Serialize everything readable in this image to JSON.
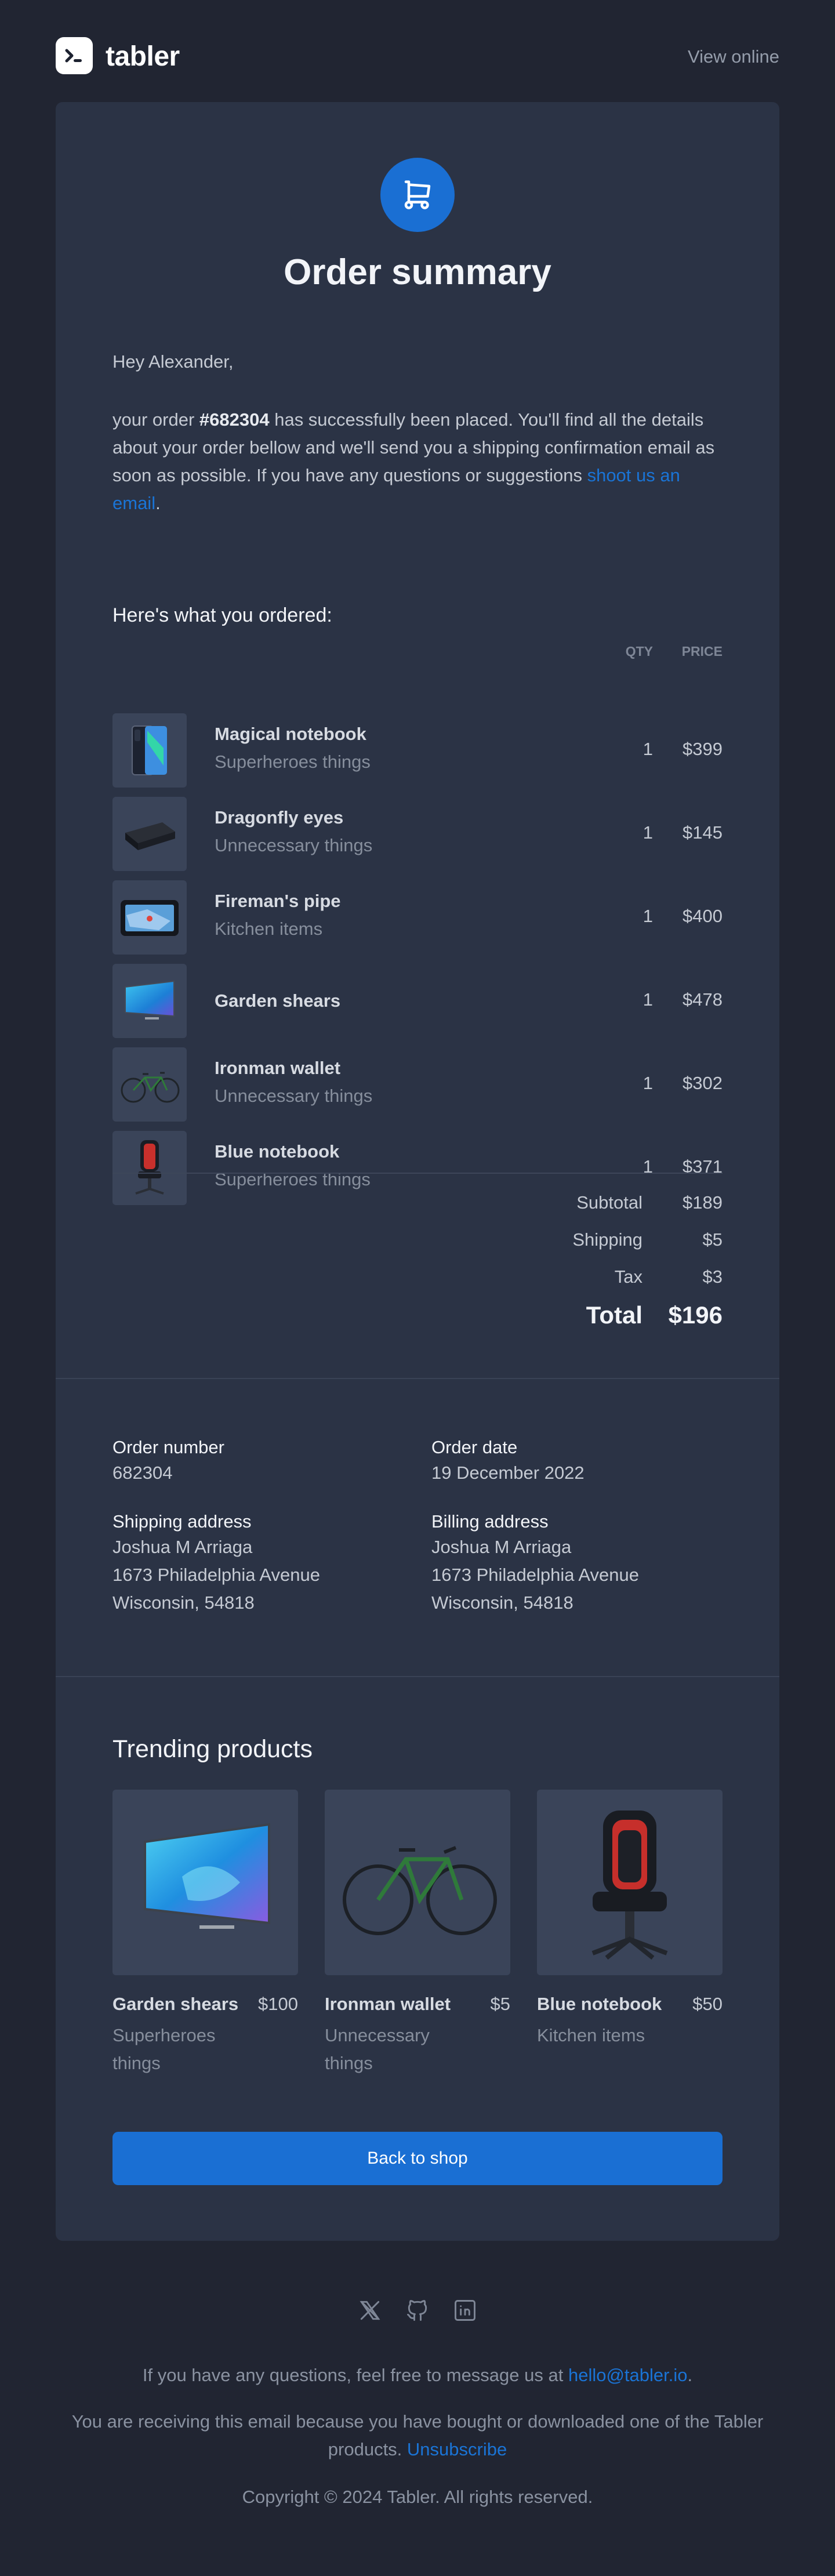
{
  "brand": {
    "name": "tabler",
    "view_online": "View online"
  },
  "colors": {
    "accent": "#1a6fd3",
    "background": "#212532",
    "card": "#2b3345",
    "link": "#1a74d6"
  },
  "order": {
    "title": "Order summary",
    "greeting": "Hey Alexander,",
    "intro_before": "your order ",
    "order_ref": "#682304",
    "intro_middle": " has successfully been placed. You'll find all the details about your order bellow and we'll send you a shipping confirmation email as soon as possible. If you have any questions or suggestions ",
    "intro_link": "shoot us an email",
    "intro_after": "."
  },
  "items": {
    "heading": "Here's what you ordered:",
    "qty_header": "QTY",
    "price_header": "PRICE",
    "rows": [
      {
        "name": "Magical notebook",
        "category": "Superheroes things",
        "qty": "1",
        "price": "$399",
        "icon": "smartphone-image"
      },
      {
        "name": "Dragonfly eyes",
        "category": "Unnecessary things",
        "qty": "1",
        "price": "$145",
        "icon": "hard-drive-image"
      },
      {
        "name": "Fireman's pipe",
        "category": "Kitchen items",
        "qty": "1",
        "price": "$400",
        "icon": "gps-device-image"
      },
      {
        "name": "Garden shears",
        "category": "",
        "qty": "1",
        "price": "$478",
        "icon": "tv-image"
      },
      {
        "name": "Ironman wallet",
        "category": "Unnecessary things",
        "qty": "1",
        "price": "$302",
        "icon": "bicycle-image"
      },
      {
        "name": "Blue notebook",
        "category": "Superheroes things",
        "qty": "1",
        "price": "$371",
        "icon": "gaming-chair-image"
      }
    ]
  },
  "summary": {
    "subtotal_label": "Subtotal",
    "subtotal": "$189",
    "shipping_label": "Shipping",
    "shipping": "$5",
    "tax_label": "Tax",
    "tax": "$3",
    "total_label": "Total",
    "total": "$196"
  },
  "details": {
    "order_number_label": "Order number",
    "order_number": "682304",
    "order_date_label": "Order date",
    "order_date": "19 December 2022",
    "shipping_label": "Shipping address",
    "shipping_lines": [
      "Joshua M Arriaga",
      "1673 Philadelphia Avenue",
      "Wisconsin, 54818"
    ],
    "billing_label": "Billing address",
    "billing_lines": [
      "Joshua M Arriaga",
      "1673 Philadelphia Avenue",
      "Wisconsin, 54818"
    ]
  },
  "trending": {
    "heading": "Trending products",
    "products": [
      {
        "name": "Garden shears",
        "price": "$100",
        "category": "Superheroes things",
        "icon": "tv-image"
      },
      {
        "name": "Ironman wallet",
        "price": "$5",
        "category": "Unnecessary things",
        "icon": "bicycle-image"
      },
      {
        "name": "Blue notebook",
        "price": "$50",
        "category": "Kitchen items",
        "icon": "gaming-chair-image"
      }
    ],
    "button": "Back to shop"
  },
  "footer": {
    "social_icons": [
      "x-icon",
      "github-icon",
      "linkedin-icon"
    ],
    "question_text": "If you have any questions, feel free to message us at ",
    "email": "hello@tabler.io",
    "question_end": ".",
    "receiving_text": "You are receiving this email because you have bought or downloaded one of the Tabler products. ",
    "unsubscribe": "Unsubscribe",
    "copyright": "Copyright © 2024 Tabler. All rights reserved."
  }
}
